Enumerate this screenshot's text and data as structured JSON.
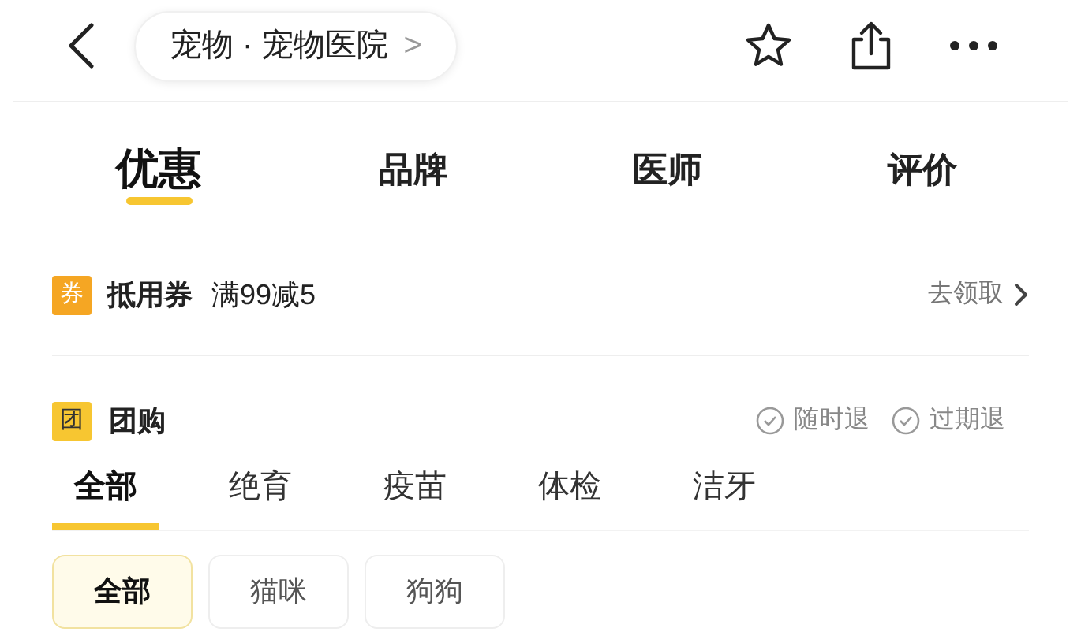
{
  "header": {
    "title": "宠物 · 宠物医院",
    "title_chevron": ">"
  },
  "main_tabs": [
    {
      "label": "优惠",
      "selected": true
    },
    {
      "label": "品牌",
      "selected": false
    },
    {
      "label": "医师",
      "selected": false
    },
    {
      "label": "评价",
      "selected": false
    }
  ],
  "coupon": {
    "badge": "券",
    "title": "抵用券",
    "offer": "满99减5",
    "action": "去领取"
  },
  "group_buy": {
    "badge": "团",
    "title": "团购",
    "guarantees": [
      "随时退",
      "过期退"
    ]
  },
  "category_tabs": [
    {
      "label": "全部",
      "selected": true
    },
    {
      "label": "绝育",
      "selected": false
    },
    {
      "label": "疫苗",
      "selected": false
    },
    {
      "label": "体检",
      "selected": false
    },
    {
      "label": "洁牙",
      "selected": false
    }
  ],
  "filter_chips": [
    {
      "label": "全部",
      "selected": true
    },
    {
      "label": "猫咪",
      "selected": false
    },
    {
      "label": "狗狗",
      "selected": false
    }
  ]
}
